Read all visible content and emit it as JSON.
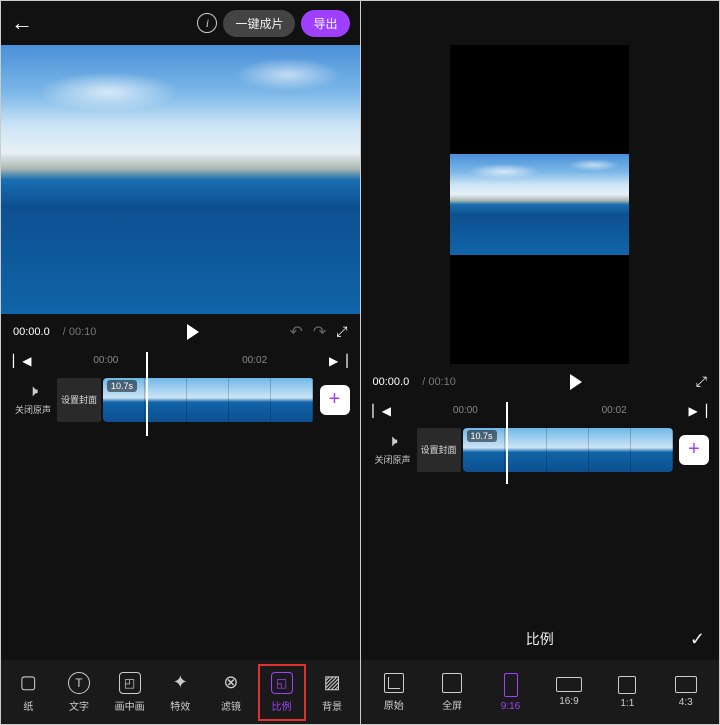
{
  "header": {
    "autocreate_label": "一键成片",
    "export_label": "导出"
  },
  "playback": {
    "current_time": "00:00.0",
    "total_time": "00:10"
  },
  "timeline": {
    "tick1": "00:00",
    "tick2": "00:02",
    "mute_label": "关闭原声",
    "cover_label": "设置封面",
    "duration_badge": "10.7s"
  },
  "toolbar": {
    "paper_label": "纸",
    "text_label": "文字",
    "pip_label": "画中画",
    "effects_label": "特效",
    "filter_label": "滤镜",
    "ratio_label": "比例",
    "background_label": "背景"
  },
  "ratio_panel": {
    "title": "比例",
    "original": "原始",
    "fullscreen": "全屏",
    "r916": "9:16",
    "r169": "16:9",
    "r11": "1:1",
    "r43": "4:3"
  }
}
